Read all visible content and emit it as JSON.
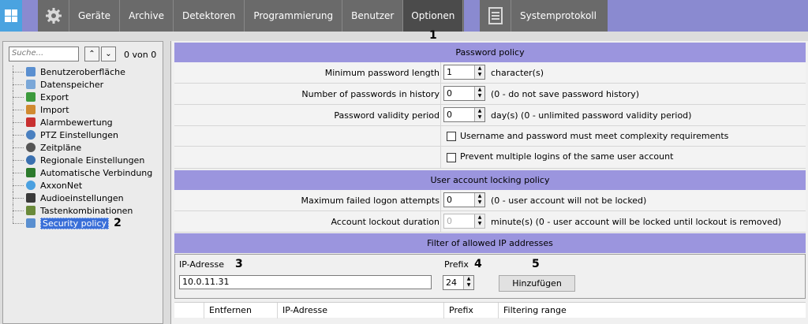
{
  "tabs": [
    {
      "label": "Geräte"
    },
    {
      "label": "Archive"
    },
    {
      "label": "Detektoren"
    },
    {
      "label": "Programmierung"
    },
    {
      "label": "Benutzer"
    },
    {
      "label": "Optionen",
      "active": true
    }
  ],
  "syslog_tab": "Systemprotokoll",
  "callouts": {
    "one": "1",
    "two": "2",
    "three": "3",
    "four": "4",
    "five": "5"
  },
  "search": {
    "placeholder": "Suche...",
    "count": "0 von 0"
  },
  "tree": [
    {
      "label": "Benutzeroberfläche",
      "color": "#5a8fd0"
    },
    {
      "label": "Datenspeicher",
      "color": "#7aa7d8"
    },
    {
      "label": "Export",
      "color": "#3c9a3c"
    },
    {
      "label": "Import",
      "color": "#d08a30"
    },
    {
      "label": "Alarmbewertung",
      "color": "#c83030"
    },
    {
      "label": "PTZ Einstellungen",
      "color": "#4a80c0"
    },
    {
      "label": "Zeitpläne",
      "color": "#555555"
    },
    {
      "label": "Regionale Einstellungen",
      "color": "#3a70b0"
    },
    {
      "label": "Automatische Verbindung",
      "color": "#2c7a2c"
    },
    {
      "label": "AxxonNet",
      "color": "#4aa0e0"
    },
    {
      "label": "Audioeinstellungen",
      "color": "#3a3a3a"
    },
    {
      "label": "Tastenkombinationen",
      "color": "#6a8a3a"
    },
    {
      "label": "Security policy",
      "color": "#5a8fd0",
      "selected": true
    }
  ],
  "password_policy": {
    "title": "Password policy",
    "min_length": {
      "label": "Minimum password length",
      "value": "1",
      "unit": "character(s)"
    },
    "history": {
      "label": "Number of passwords in history",
      "value": "0",
      "note": "(0 - do not save password history)"
    },
    "validity": {
      "label": "Password validity period",
      "value": "0",
      "note": "day(s) (0 - unlimited password validity period)"
    },
    "complexity": "Username and password must meet complexity requirements",
    "multi_login": "Prevent multiple logins of the same user account"
  },
  "locking_policy": {
    "title": "User account locking policy",
    "max_attempts": {
      "label": "Maximum failed logon attempts",
      "value": "0",
      "note": "(0 - user account will not be locked)"
    },
    "lockout": {
      "label": "Account lockout duration",
      "value": "0",
      "note": "minute(s) (0 - user account will be locked until lockout is removed)"
    }
  },
  "ip_filter": {
    "title": "Filter of allowed IP addresses",
    "ip_label": "IP-Adresse",
    "ip_value": "10.0.11.31",
    "prefix_label": "Prefix",
    "prefix_value": "24",
    "add_button": "Hinzufügen",
    "columns": [
      "Entfernen",
      "IP-Adresse",
      "Prefix",
      "Filtering range"
    ]
  }
}
